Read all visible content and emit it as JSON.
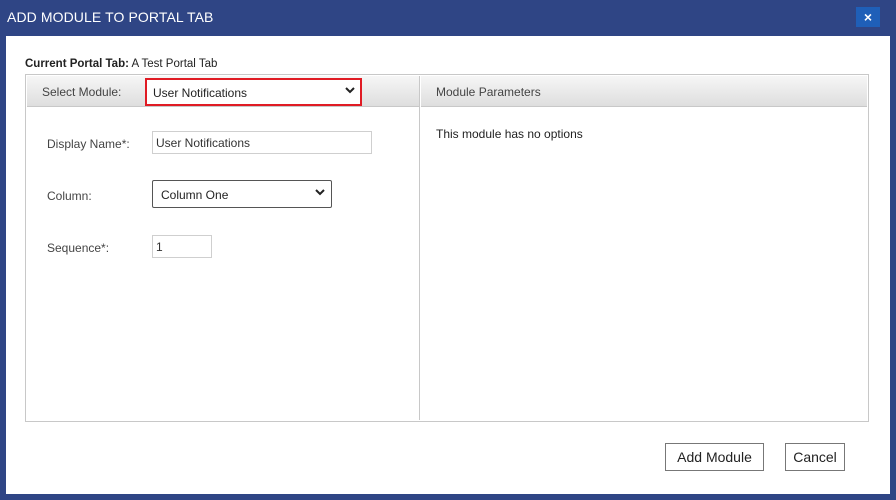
{
  "window": {
    "title": "ADD MODULE TO PORTAL TAB",
    "close_label": "×"
  },
  "portal": {
    "label": "Current Portal Tab:",
    "value": "A Test Portal Tab"
  },
  "left_panel": {
    "select_module_label": "Select Module:",
    "select_module_value": "User Notifications",
    "display_name_label": "Display Name*:",
    "display_name_value": "User Notifications",
    "column_label": "Column:",
    "column_value": "Column One",
    "sequence_label": "Sequence*:",
    "sequence_value": "1"
  },
  "right_panel": {
    "header": "Module Parameters",
    "message": "This module has no options"
  },
  "buttons": {
    "add_module": "Add Module",
    "cancel": "Cancel"
  },
  "colors": {
    "titlebar": "#2f4585",
    "close_button": "#1f5fb8",
    "highlight": "#e01b24"
  },
  "icons": {
    "close": "close-icon",
    "dropdown": "chevron-down-icon"
  }
}
